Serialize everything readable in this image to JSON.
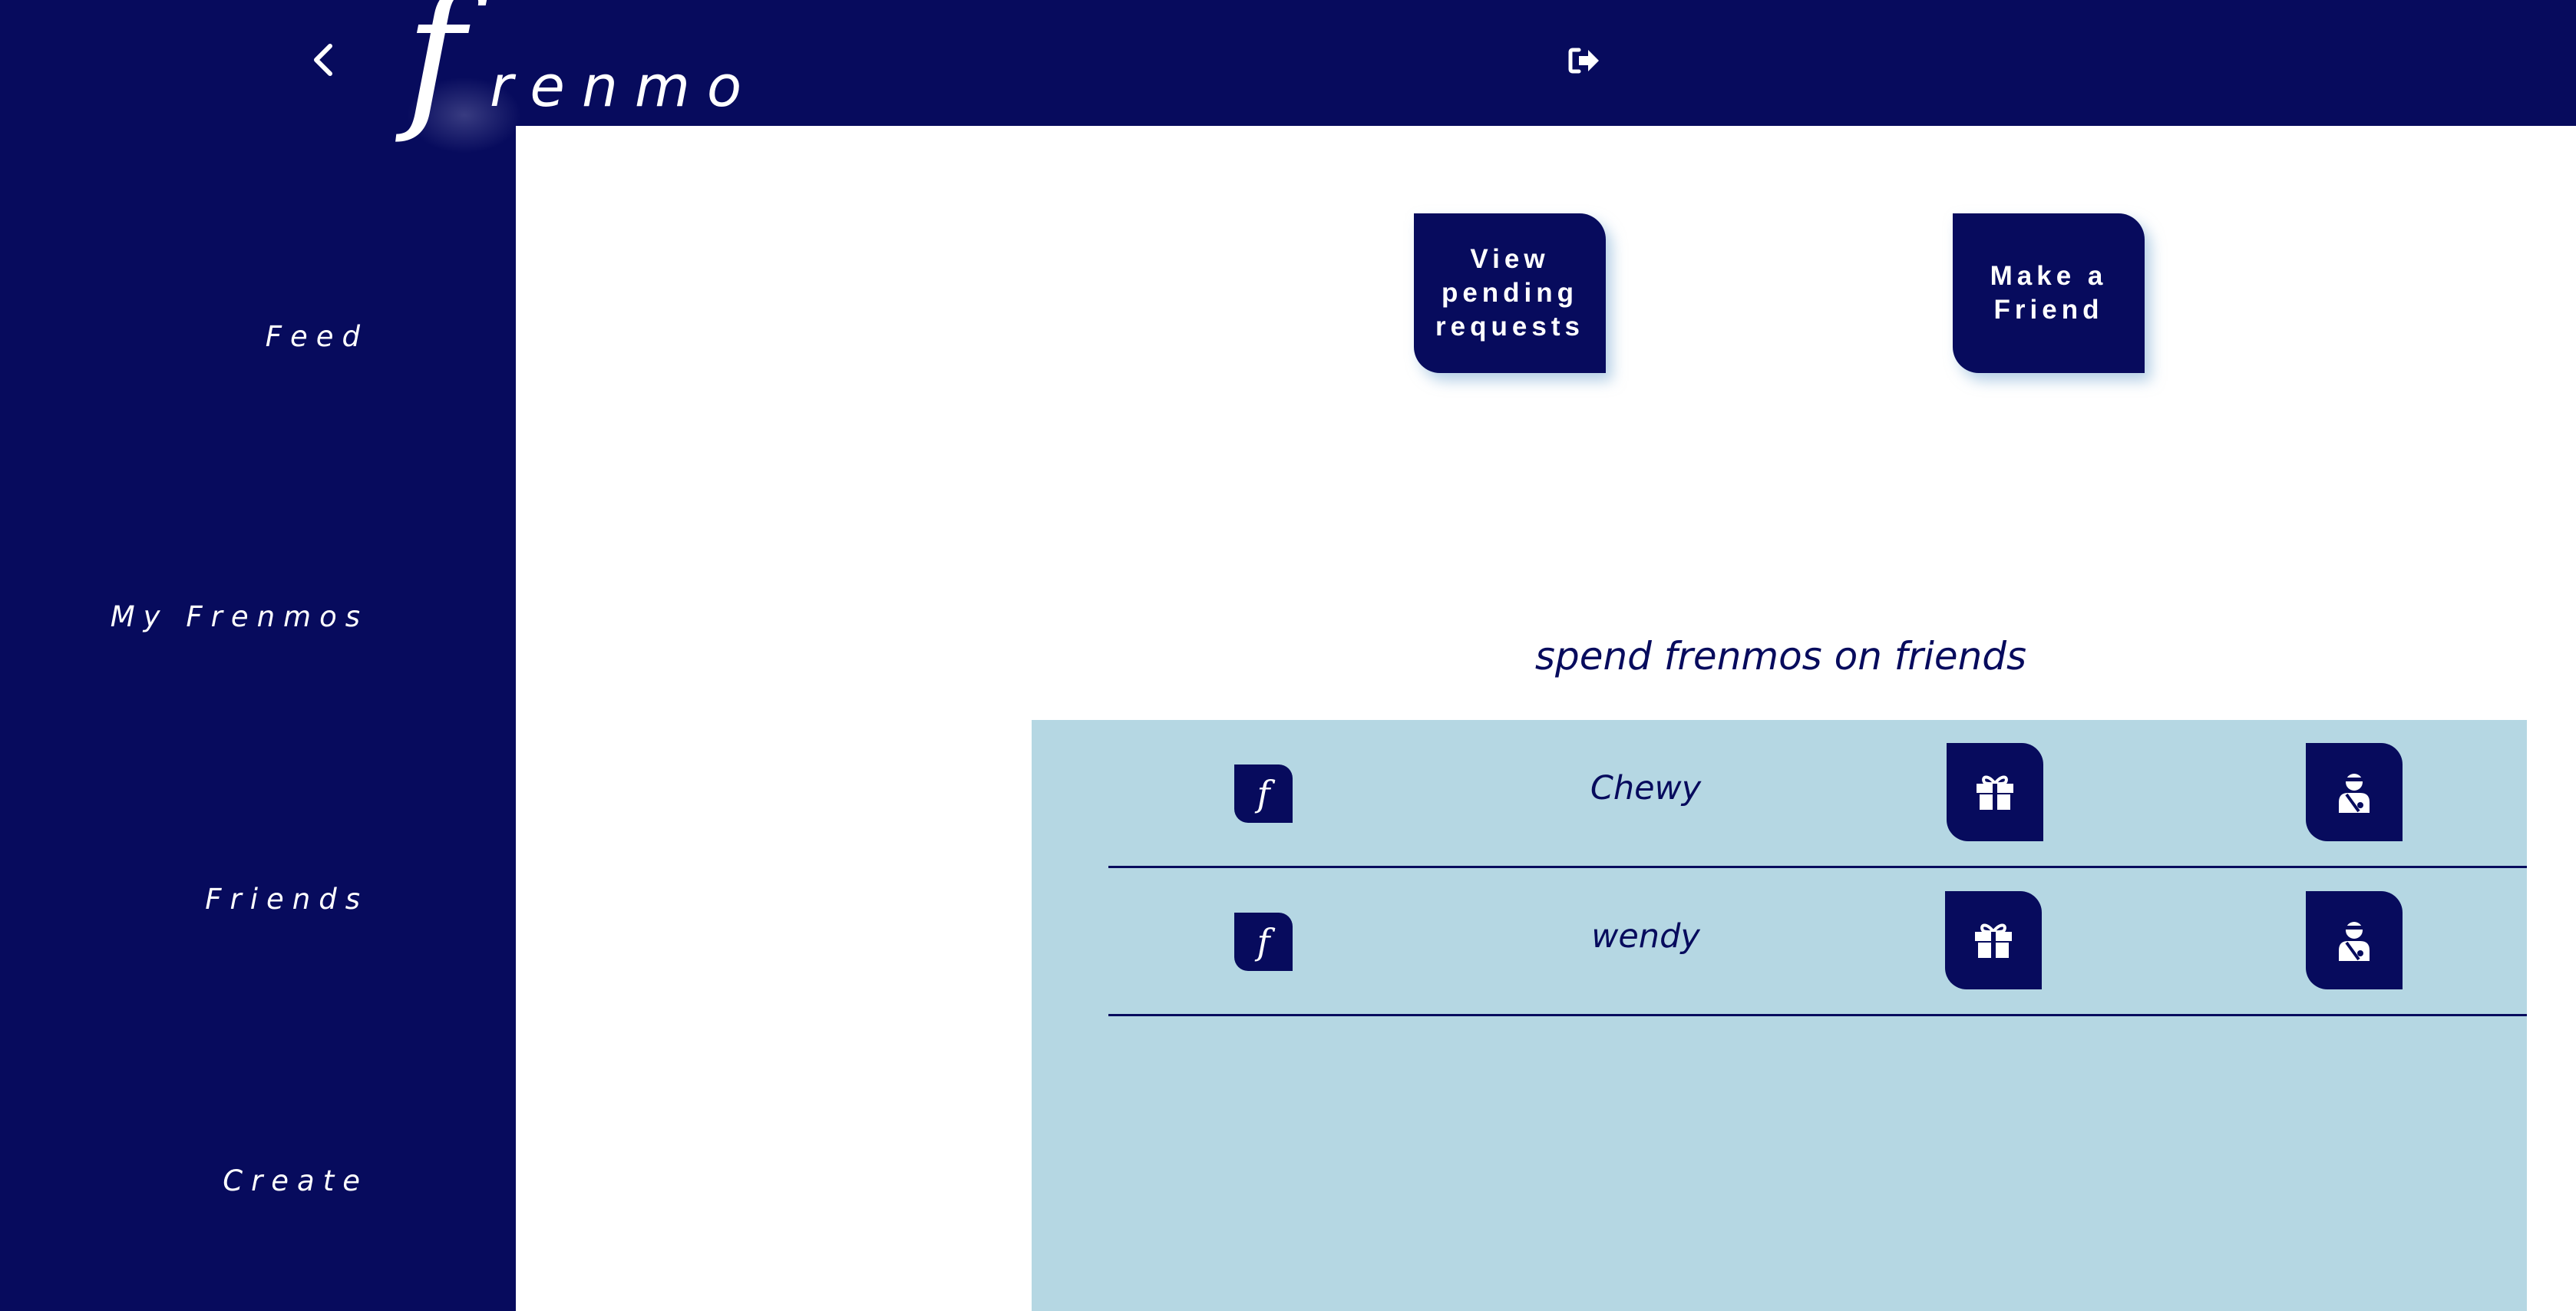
{
  "colors": {
    "navy": "#070b5d",
    "panel": "#b5d7e3",
    "white": "#ffffff"
  },
  "header": {
    "back_icon": "chevron-left-icon",
    "logo": {
      "f": "f",
      "rest": "renmo"
    },
    "logout_icon": "sign-out-icon"
  },
  "sidebar": {
    "items": [
      {
        "label": "Feed"
      },
      {
        "label": "My Frenmos"
      },
      {
        "label": "Friends"
      },
      {
        "label": "Create"
      }
    ]
  },
  "actions": {
    "pending_label": "View pending requests",
    "make_friend_label": "Make a Friend"
  },
  "friends_section": {
    "title": "spend frenmos on friends",
    "rows": [
      {
        "logo": "f",
        "name": "Chewy",
        "gift_icon": "gift-icon",
        "user_icon": "user-injured-icon"
      },
      {
        "logo": "f",
        "name": "wendy",
        "gift_icon": "gift-icon",
        "user_icon": "user-injured-icon"
      }
    ]
  }
}
